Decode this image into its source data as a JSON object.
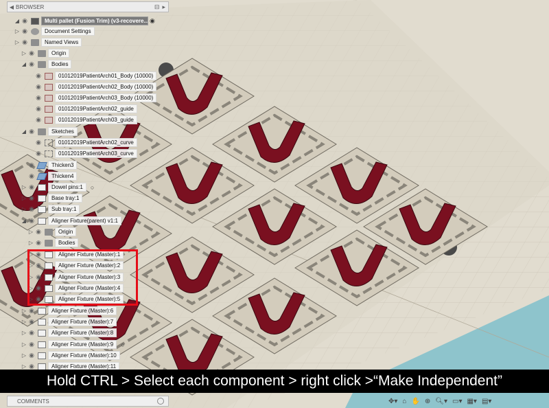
{
  "browser": {
    "header_label": "BROWSER",
    "root": "Multi pallet (Fusion Trim) (v3-recovere...",
    "items": [
      {
        "label": "Document Settings",
        "icon": "gear-icon"
      },
      {
        "label": "Named Views",
        "icon": "folder-icon"
      },
      {
        "label": "Origin",
        "icon": "folder-icon"
      },
      {
        "label": "Bodies",
        "icon": "folder-icon"
      },
      {
        "label": "01012019PatientArch01_Body (10000)",
        "icon": "body-icon"
      },
      {
        "label": "01012019PatientArch02_Body  (10000)",
        "icon": "body-icon"
      },
      {
        "label": "01012019PatientArch03_Body (10000)",
        "icon": "body-icon"
      },
      {
        "label": "01012019PatientArch02_guide",
        "icon": "body-icon"
      },
      {
        "label": "01012019PatientArch03_guide",
        "icon": "body-icon"
      },
      {
        "label": "Sketches",
        "icon": "folder-icon"
      },
      {
        "label": "01012019PatientArch02_curve",
        "icon": "sketch-icon"
      },
      {
        "label": "01012019PatientArch03_curve",
        "icon": "sketch-icon"
      },
      {
        "label": "Thicken3",
        "icon": "thicken-icon"
      },
      {
        "label": "Thicken4",
        "icon": "thicken-icon"
      },
      {
        "label": "Dowel pins:1",
        "icon": "component-icon"
      },
      {
        "label": "Base tray:1",
        "icon": "component-icon"
      },
      {
        "label": "Sub tray:1",
        "icon": "component-icon"
      },
      {
        "label": "Aligner Fixture(parent) v1:1",
        "icon": "component-icon"
      },
      {
        "label": "Origin",
        "icon": "folder-icon"
      },
      {
        "label": "Bodies",
        "icon": "folder-icon"
      },
      {
        "label": "Aligner Fixture (Master):1",
        "icon": "component-icon"
      },
      {
        "label": "Aligner Fixture (Master):2",
        "icon": "component-icon"
      },
      {
        "label": "Aligner Fixture (Master):3",
        "icon": "component-icon"
      },
      {
        "label": "Aligner Fixture (Master):4",
        "icon": "component-icon"
      },
      {
        "label": "Aligner Fixture (Master):5",
        "icon": "component-icon"
      },
      {
        "label": "Aligner Fixture (Master):6",
        "icon": "component-icon"
      },
      {
        "label": "Aligner Fixture (Master):7",
        "icon": "component-icon"
      },
      {
        "label": "Aligner Fixture (Master):8",
        "icon": "component-icon"
      },
      {
        "label": "Aligner Fixture (Master):9",
        "icon": "component-icon"
      },
      {
        "label": "Aligner Fixture (Master):10",
        "icon": "component-icon"
      },
      {
        "label": "Aligner Fixture (Master):11",
        "icon": "component-icon"
      }
    ]
  },
  "caption": "Hold CTRL > Select each component > right click >“Make Independent”",
  "comments_label": "COMMENTS",
  "colors": {
    "highlight": "#e50d18",
    "aligner": "#7a1020",
    "plate": "#cfc8b8"
  }
}
